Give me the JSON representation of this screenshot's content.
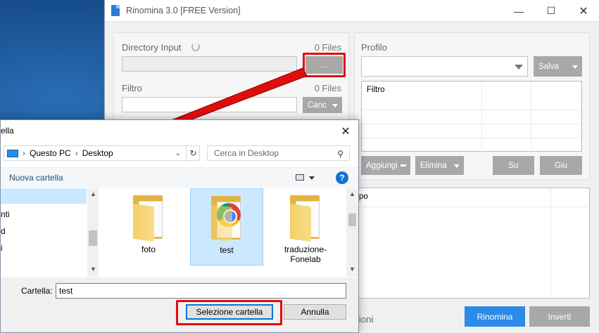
{
  "app": {
    "title": "Rinomina 3.0 [FREE Version]",
    "directory_input_label": "Directory Input",
    "directory_files_count": "0 Files",
    "browse_button_label": "...",
    "filter_label": "Filtro",
    "filter_files_count": "0 Files",
    "filter_cancel_label": "Canc",
    "profile_label": "Profilo",
    "profile_save_label": "Salva",
    "filter_grid_header": "Filtro",
    "add_label": "Aggiungi",
    "delete_label": "Elimina",
    "up_label": "Su",
    "down_label": "Giu",
    "bottom_grid_partial_header": "po",
    "bottom_partial_label": "ioni",
    "rename_label": "Rinomina",
    "invert_label": "Inverti"
  },
  "dialog": {
    "title_partial": "ella",
    "breadcrumb": [
      "Questo PC",
      "Desktop"
    ],
    "search_placeholder": "Cerca in Desktop",
    "new_folder_label": "Nuova cartella",
    "nav_items": [
      "nti",
      "d",
      "i"
    ],
    "files": [
      {
        "name": "foto",
        "icon": "folder-icon",
        "selected": false
      },
      {
        "name": "test",
        "icon": "chrome-folder-icon",
        "selected": true
      },
      {
        "name": "traduzione-Fonelab",
        "icon": "folder-icon",
        "selected": false
      }
    ],
    "folder_label": "Cartella:",
    "folder_value": "test",
    "select_button_label": "Selezione cartella",
    "cancel_button_label": "Annulla"
  },
  "colors": {
    "annotation_red": "#e10d0d",
    "primary_blue": "#2b8be6",
    "button_gray": "#a8a8a8",
    "selection_blue": "#cce8ff"
  }
}
